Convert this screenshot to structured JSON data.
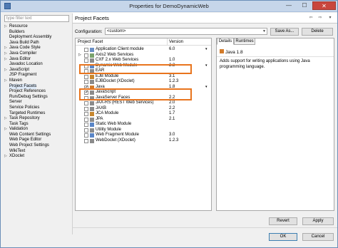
{
  "window": {
    "title": "Properties for DemoDynamicWeb"
  },
  "titlebar_buttons": {
    "minimize": "—",
    "maximize": "☐",
    "close": "✕"
  },
  "filter": {
    "placeholder": "type filter text"
  },
  "tree": [
    {
      "label": "Resource",
      "arrow": "▷"
    },
    {
      "label": "Builders",
      "arrow": ""
    },
    {
      "label": "Deployment Assembly",
      "arrow": ""
    },
    {
      "label": "Java Build Path",
      "arrow": ""
    },
    {
      "label": "Java Code Style",
      "arrow": "▷"
    },
    {
      "label": "Java Compiler",
      "arrow": "▷"
    },
    {
      "label": "Java Editor",
      "arrow": "▷"
    },
    {
      "label": "Javadoc Location",
      "arrow": ""
    },
    {
      "label": "JavaScript",
      "arrow": "▷"
    },
    {
      "label": "JSP Fragment",
      "arrow": ""
    },
    {
      "label": "Maven",
      "arrow": "▷"
    },
    {
      "label": "Project Facets",
      "arrow": "",
      "selected": true
    },
    {
      "label": "Project References",
      "arrow": ""
    },
    {
      "label": "Run/Debug Settings",
      "arrow": ""
    },
    {
      "label": "Server",
      "arrow": ""
    },
    {
      "label": "Service Policies",
      "arrow": ""
    },
    {
      "label": "Targeted Runtimes",
      "arrow": ""
    },
    {
      "label": "Task Repository",
      "arrow": "▷"
    },
    {
      "label": "Task Tags",
      "arrow": ""
    },
    {
      "label": "Validation",
      "arrow": "▷"
    },
    {
      "label": "Web Content Settings",
      "arrow": ""
    },
    {
      "label": "Web Page Editor",
      "arrow": ""
    },
    {
      "label": "Web Project Settings",
      "arrow": ""
    },
    {
      "label": "WikiText",
      "arrow": ""
    },
    {
      "label": "XDoclet",
      "arrow": "▷"
    }
  ],
  "page": {
    "title": "Project Facets",
    "nav_back": "⇦",
    "nav_fwd": "⇨",
    "nav_menu": "▾"
  },
  "configuration": {
    "label": "Configuration:",
    "value": "<custom>",
    "save_as": "Save As...",
    "delete": "Delete"
  },
  "facets_table": {
    "col_facet": "Project Facet",
    "col_version": "Version",
    "rows": [
      {
        "name": "Application Client module",
        "version": "6.0",
        "checked": false,
        "dd": "▾",
        "icon": "#6a8fc4"
      },
      {
        "name": "Axis2 Web Services",
        "version": "",
        "checked": false,
        "dd": "",
        "icon": "#7aa36c",
        "arrow": "▷"
      },
      {
        "name": "CXF 2.x Web Services",
        "version": "1.0",
        "checked": false,
        "dd": "",
        "icon": "#8b8b8b"
      },
      {
        "name": "Dynamic Web Module",
        "version": "2.3",
        "checked": false,
        "dd": "▾",
        "icon": "#5a86c8"
      },
      {
        "name": "EAR",
        "version": "",
        "checked": false,
        "dd": "",
        "icon": "#8b8b8b"
      },
      {
        "name": "EJB Module",
        "version": "3.1",
        "checked": false,
        "dd": "",
        "icon": "#c7872f"
      },
      {
        "name": "EJBDoclet (XDoclet)",
        "version": "1.2.3",
        "checked": false,
        "dd": "",
        "icon": "#8b8b8b"
      },
      {
        "name": "Java",
        "version": "1.8",
        "checked": true,
        "dd": "▾",
        "icon": "#d27b2a"
      },
      {
        "name": "JavaScript",
        "version": "",
        "checked": true,
        "dd": "",
        "icon": "#8b8b8b"
      },
      {
        "name": "JavaServer Faces",
        "version": "2.2",
        "checked": false,
        "dd": "",
        "icon": "#8b8b8b"
      },
      {
        "name": "JAX-RS (REST Web Services)",
        "version": "2.0",
        "checked": false,
        "dd": "",
        "icon": "#8b8b8b"
      },
      {
        "name": "JAXB",
        "version": "2.2",
        "checked": false,
        "dd": "",
        "icon": "#8b8b8b"
      },
      {
        "name": "JCA Module",
        "version": "1.7",
        "checked": false,
        "dd": "",
        "icon": "#c7872f"
      },
      {
        "name": "JPA",
        "version": "2.1",
        "checked": false,
        "dd": "",
        "icon": "#8b8b8b"
      },
      {
        "name": "Static Web Module",
        "version": "",
        "checked": false,
        "dd": "",
        "icon": "#5a86c8"
      },
      {
        "name": "Utility Module",
        "version": "",
        "checked": false,
        "dd": "",
        "icon": "#8b8b8b"
      },
      {
        "name": "Web Fragment Module",
        "version": "3.0",
        "checked": false,
        "dd": "",
        "icon": "#5a86c8"
      },
      {
        "name": "WebDoclet (XDoclet)",
        "version": "1.2.3",
        "checked": false,
        "dd": "",
        "icon": "#8b8b8b"
      }
    ]
  },
  "details": {
    "tab_details": "Details",
    "tab_runtimes": "Runtimes",
    "heading": "Java 1.8",
    "description": "Adds support for writing applications using Java programming language."
  },
  "buttons": {
    "revert": "Revert",
    "apply": "Apply",
    "ok": "OK",
    "cancel": "Cancel"
  },
  "colors": {
    "highlight_box": "#e8741d",
    "title_bar": "#c6d6ea",
    "close": "#c9463d"
  }
}
